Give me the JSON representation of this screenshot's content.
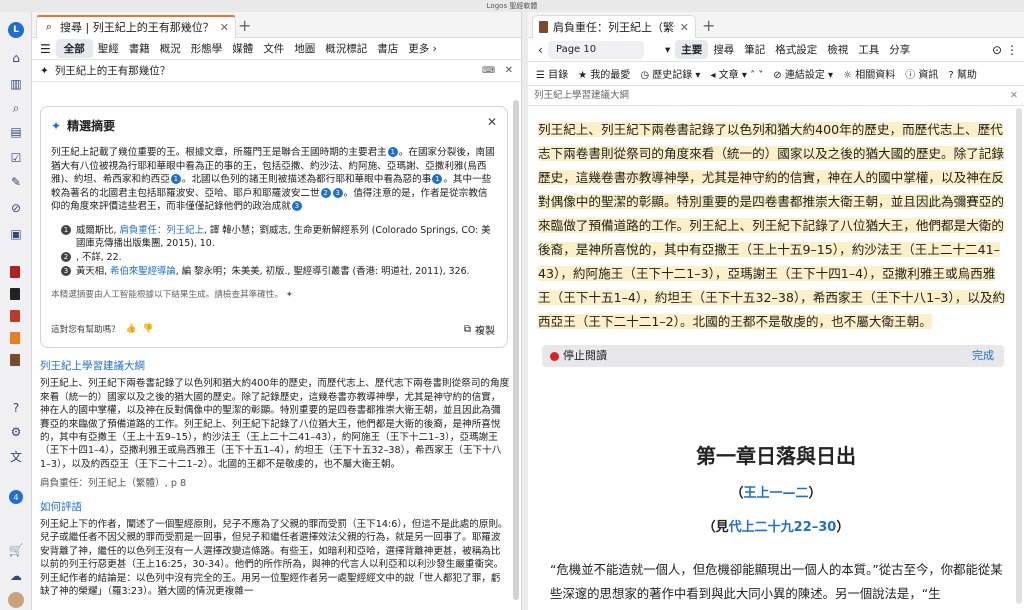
{
  "window": {
    "title": "Logos 聖經軟體"
  },
  "rail_icons": [
    "logo-icon",
    "home-icon",
    "library-icon",
    "search-icon",
    "guides-icon",
    "checklist-icon",
    "notes-icon",
    "prayer-icon",
    "book-red",
    "book-dark",
    "book-red2",
    "book-orange",
    "book-brown",
    "help-icon",
    "settings-icon",
    "translate-icon",
    "notification-badge",
    "cart-icon",
    "cloud-icon",
    "avatar"
  ],
  "rail_badge": "4",
  "left": {
    "tab_title": "搜尋 | 列王紀上的王有那幾位？| 全部",
    "nav": [
      "全部",
      "聖經",
      "書籍",
      "概況",
      "形態學",
      "媒體",
      "文件",
      "地圖",
      "概況標記",
      "書店",
      "更多"
    ],
    "query": "列王紀上的王有那幾位？",
    "summary": {
      "title": "精選摘要",
      "text_parts": [
        "列王紀上記載了幾位重要的王。根據文章，所羅門王是聯合王國時期的主要君主",
        "。在國家分裂後，南國猶大有八位被視為行耶和華眼中看為正的事的王，包括亞撒、約沙法、約阿施、亞瑪謝、亞撒利雅(烏西雅)、約坦、希西家和約西亞",
        "。北國以色列的諸王則被描述為都行耶和華眼中看為惡的事",
        "。其中一些較為著名的北國君主包括耶羅波安、亞哈、耶戶和耶羅波安二世",
        "。值得注意的是，作者是從宗教信仰的角度來評價這些君王，而非僅僅記錄他們的政治成就"
      ],
      "refs": [
        {
          "n": "1",
          "a": "威爾斯比, ",
          "link": "肩負重任：列王紀上",
          "b": ", 譯 韓小慧；劉威志, 生命更新解經系列 (Colorado Springs, CO: 美國庫克傳播出版集團, 2015), 10."
        },
        {
          "n": "2",
          "a": ", 不詳, 22.",
          "link": "",
          "b": ""
        },
        {
          "n": "3",
          "a": "黃天相, ",
          "link": "希伯來聖經導論",
          "b": ", 編 黎永明；朱美美, 初版., 聖經導引叢書 (香港: 明道社, 2011), 326."
        }
      ],
      "disclaimer": "本精選摘要由人工智能根據以下結果生成。請檢查其準確性。",
      "feedback": "這對您有幫助嗎？",
      "copy": "複製"
    },
    "result": {
      "title": "列王紀上學習建議大綱",
      "body": "列王紀上、列王紀下兩卷書記錄了以色列和猶大約400年的歷史，而歷代志上、歷代志下兩卷書則從祭司的角度來看（統一的）國家以及之後的猶大國的歷史。除了記錄歷史，這幾卷書亦教導神學，尤其是神守約的信實，神在人的國中掌權，以及神在反對偶像中的聖潔的彰顯。特別重要的是四卷書都推崇大衛王朝，並且因此為彌賽亞的來臨做了預備道路的工作。列王紀上、列王紀下記錄了八位猶大王，他們都是大衛的後裔，是神所喜悅的，其中有亞撒王（王上十五9–15），約沙法王（王上二十二41–43），約阿施王（王下十二1–3），亞瑪謝王（王下十四1–4），亞撒利雅王或烏西雅王（王下十五1–4），約坦王（王下十五32–38），希西家王（王下十八1–3），以及約西亞王（王下二十二1–2）。北國的王都不是敬虔的，也不屬大衛王朝。",
      "source": "肩負重任：列王紀上（繁體）, p 8",
      "title2": "如何評語",
      "body2": "列王紀上下的作者，闡述了一個聖經原則，兒子不應為了父親的罪而受罰（王下14:6），但這不是此處的原則。兒子或繼任者不因父親的罪而受罰是一回事，但兒子和繼任者選擇效法父親的行為，就是另一回事了。耶羅波安背離了神，繼任的以色列王沒有一人選擇改變這條路。有些王，如暗利和亞哈，選擇背離神更甚，被稱為比以前的列王行惡更甚（王上16:25，30-34）。他們的所作所為，與神的代言人以利亞和以利沙發生嚴重衝突。列王紀作者的結論是：以色列中沒有完全的王。用另一位聖經作者另一處聖經經文中的說「世人都犯了罪，虧缺了神的榮耀」（羅3:23）。猶大國的情況更複雜一"
    }
  },
  "right": {
    "tab_title": "肩負重任：列王紀上（繁體）",
    "page_box": "Page 10",
    "menu": [
      "主要",
      "搜尋",
      "筆記",
      "格式設定",
      "檢視",
      "工具",
      "分享"
    ],
    "toolbar2": [
      "目錄",
      "我的最愛",
      "歷史記錄",
      "文章",
      "連結設定",
      "相關資料",
      "資訊",
      "幫助"
    ],
    "header": "列王紀上學習建議大綱",
    "reading": "列王紀上、列王紀下兩卷書記錄了以色列和猶大約400年的歷史，而歷代志上、歷代志下兩卷書則從祭司的角度來看（統一的）國家以及之後的猶大國的歷史。除了記錄歷史，這幾卷書亦教導神學，尤其是神守約的信實，神在人的國中掌權，以及神在反對偶像中的聖潔的彰顯。特別重要的是四卷書都推崇大衛王朝，並且因此為彌賽亞的來臨做了預備道路的工作。列王紀上、列王紀下記錄了八位猶大王，他們都是大衛的後裔，是神所喜悅的，其中有亞撒王（王上十五9–15），約沙法王（王上二十二41–43），約阿施王（王下十二1–3），亞瑪謝王（王下十四1–4），亞撒利雅王或烏西雅王（王下十五1–4），約坦王（王下十五32–38），希西家王（王下十八1–3），以及約西亞王（王下二十二1–2）。北國的王都不是敬虔的，也不屬大衛王朝。",
    "stop_reading": "停止閱讀",
    "done": "完成",
    "chapter_title": "第一章日落與日出",
    "chapter_ref1": "王上一—二",
    "chapter_ref2_prefix": "見",
    "chapter_ref2_link": "代上二十九22–30",
    "paragraph": "“危機並不能造就一個人，但危機卻能顯現出一個人的本質。”從古至今，你都能從某些深邃的思想家的著作中看到與此大同小異的陳述。另一個說法是，“生"
  }
}
